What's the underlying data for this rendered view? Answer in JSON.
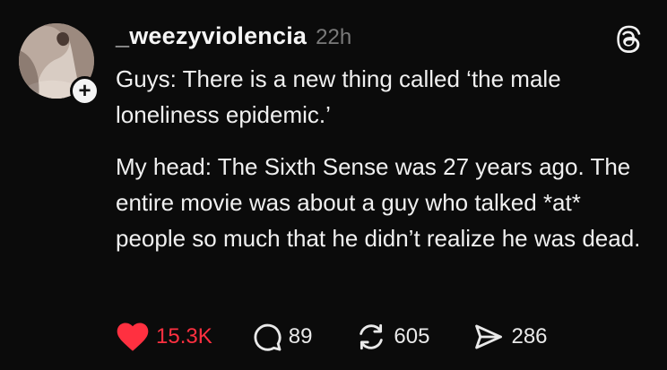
{
  "post": {
    "author": {
      "username": "_weezyviolencia",
      "timestamp": "22h"
    },
    "follow_badge": "+",
    "paragraphs": [
      "Guys: There is a new thing called ‘the male loneliness epidemic.’",
      "My head: The Sixth Sense was 27 years ago. The entire movie was about a guy who talked *at* people so much that he didn’t realize he was dead."
    ],
    "stats": {
      "likes": "15.3K",
      "replies": "89",
      "reposts": "605",
      "shares": "286"
    }
  },
  "icons": {
    "like": "heart-icon",
    "reply": "comment-bubble-icon",
    "repost": "repost-icon",
    "share": "send-icon",
    "brand": "threads-logo-icon"
  },
  "colors": {
    "background": "#0b0b0b",
    "like_active": "#ff3040",
    "timestamp": "#7a7a7a",
    "text": "#f0f0f0"
  }
}
